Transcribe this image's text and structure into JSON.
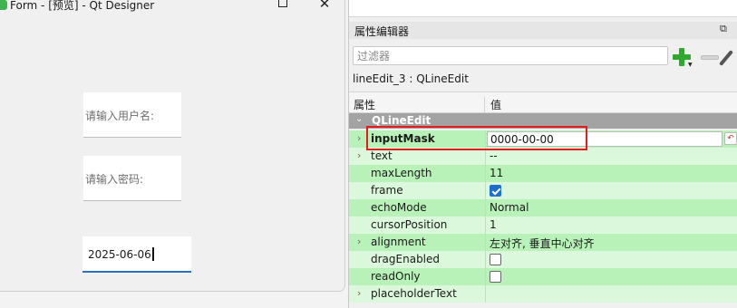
{
  "preview_window": {
    "title": "Form - [预览] - Qt Designer",
    "minimize_glyph": "—",
    "close_glyph": "✕",
    "username_placeholder": "请输入用户名:",
    "password_placeholder": "请输入密码:",
    "date_value": "2025-06-06"
  },
  "property_editor": {
    "title": "属性编辑器",
    "float_glyph": "⧉",
    "filter_placeholder": "过滤器",
    "object_label": "lineEdit_3 : QLineEdit",
    "columns": {
      "property": "属性",
      "value": "值"
    },
    "group": {
      "arrow": "⌄",
      "name": "QLineEdit"
    },
    "rows": [
      {
        "expander": "›",
        "name": "inputMask",
        "value": "0000-00-00"
      },
      {
        "expander": "›",
        "name": "text",
        "value": "--"
      },
      {
        "name": "maxLength",
        "value": "11"
      },
      {
        "name": "frame",
        "checked": true
      },
      {
        "name": "echoMode",
        "value": "Normal"
      },
      {
        "name": "cursorPosition",
        "value": "1"
      },
      {
        "expander": "›",
        "name": "alignment",
        "value": "左对齐, 垂直中心对齐"
      },
      {
        "name": "dragEnabled",
        "checked": false
      },
      {
        "name": "readOnly",
        "checked": false
      },
      {
        "expander": "›",
        "name": "placeholderText",
        "value": ""
      }
    ],
    "reset_glyph": "↶",
    "highlight_color": "#e21d1d"
  }
}
